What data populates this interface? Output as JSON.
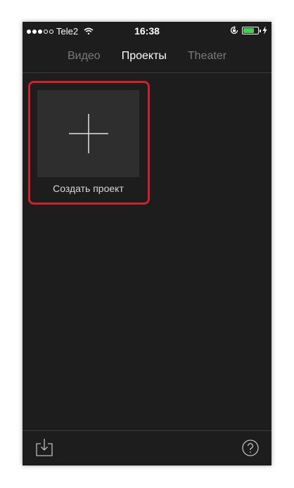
{
  "status_bar": {
    "carrier": "Tele2",
    "time": "16:38",
    "battery_level": 0.75,
    "icons": [
      "signal-dots",
      "wifi-icon",
      "rotation-lock-icon",
      "battery-icon",
      "charging-bolt-icon"
    ]
  },
  "tabs": [
    {
      "label": "Видео",
      "active": false
    },
    {
      "label": "Проекты",
      "active": true
    },
    {
      "label": "Theater",
      "active": false
    }
  ],
  "create_project": {
    "label": "Создать проект",
    "icon": "plus-icon"
  },
  "bottom_bar": {
    "left_icon": "import-icon",
    "right_icon": "help-icon"
  },
  "colors": {
    "background": "#1d1d1d",
    "tile": "#2e2e2e",
    "highlight": "#d0202e",
    "active_tab": "#ffffff",
    "inactive_tab": "#7a7a7a",
    "battery": "#3fd14f"
  }
}
